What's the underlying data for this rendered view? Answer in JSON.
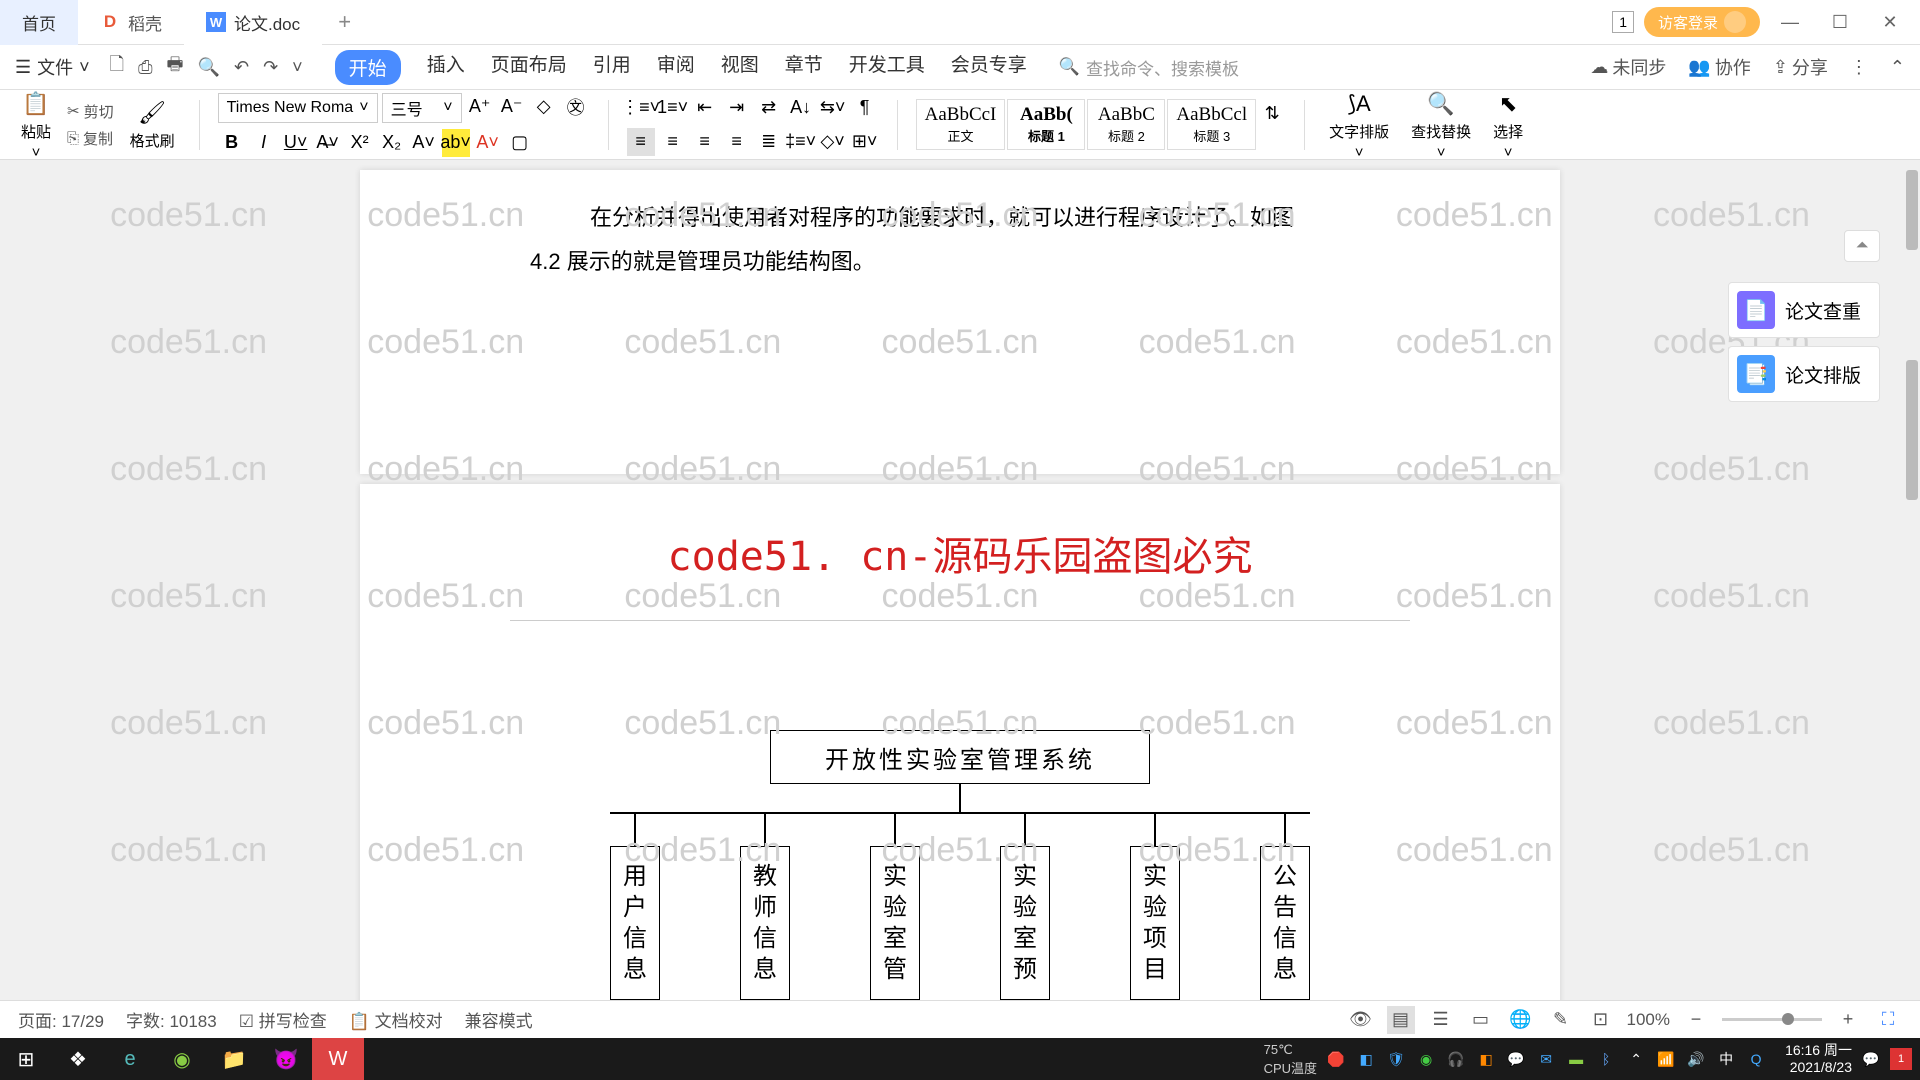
{
  "titlebar": {
    "tab_home": "首页",
    "tab_docao": "稻壳",
    "tab_doc": "论文.doc",
    "login": "访客登录",
    "window_count": "1"
  },
  "menubar": {
    "file": "文件",
    "items": [
      "开始",
      "插入",
      "页面布局",
      "引用",
      "审阅",
      "视图",
      "章节",
      "开发工具",
      "会员专享"
    ],
    "search_placeholder": "查找命令、搜索模板",
    "unsync": "未同步",
    "collab": "协作",
    "share": "分享"
  },
  "ribbon": {
    "paste": "粘贴",
    "cut": "剪切",
    "copy": "复制",
    "format_painter": "格式刷",
    "font_name": "Times New Roma",
    "font_size": "三号",
    "styles": [
      {
        "sample": "AaBbCcI",
        "name": "正文"
      },
      {
        "sample": "AaBb(",
        "name": "标题 1"
      },
      {
        "sample": "AaBbC",
        "name": "标题 2"
      },
      {
        "sample": "AaBbCcl",
        "name": "标题 3"
      }
    ],
    "text_layout": "文字排版",
    "find_replace": "查找替换",
    "select": "选择"
  },
  "document": {
    "para1": "在分析并得出使用者对程序的功能要求时，就可以进行程序设计了。如图",
    "para2": "4.2 展示的就是管理员功能结构图。",
    "banner": "code51. cn-源码乐园盗图必究",
    "org_root": "开放性实验室管理系统",
    "org_children": [
      "用户信息",
      "教师信息",
      "实验室管",
      "实验室预",
      "实验项目",
      "公告信息"
    ]
  },
  "sidepanel": {
    "item1": "论文查重",
    "item2": "论文排版"
  },
  "watermark": "code51.cn",
  "statusbar": {
    "page": "页面: 17/29",
    "words": "字数: 10183",
    "spell": "拼写检查",
    "proof": "文档校对",
    "compat": "兼容模式",
    "zoom": "100%"
  },
  "taskbar": {
    "cpu_temp": "CPU温度",
    "temp": "75℃",
    "ime": "中",
    "time": "16:16 周一",
    "date": "2021/8/23"
  }
}
